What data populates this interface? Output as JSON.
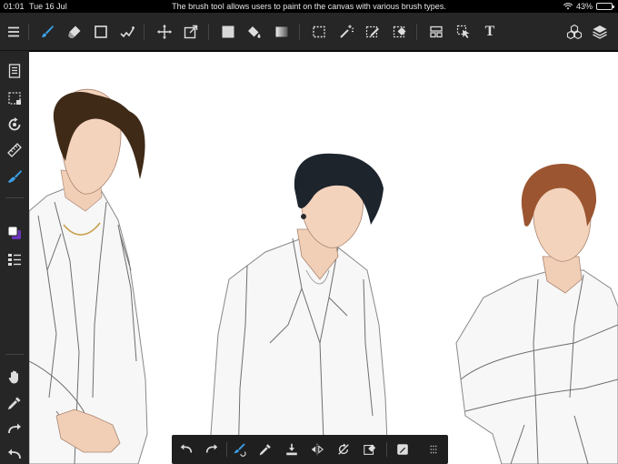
{
  "status_bar": {
    "time": "01:01",
    "date": "Tue 16 Jul",
    "tooltip": "The brush tool allows users to paint on the canvas with various brush types.",
    "battery": "43%",
    "battery_level": 0.43
  },
  "colors": {
    "accent": "#3ba0e6",
    "toolbar_bg": "#262626",
    "canvas_bg": "#ffffff",
    "primary_color": "#ffffff",
    "secondary_color": "#6a35b8"
  },
  "top_toolbar": {
    "items": [
      "menu-icon",
      "brush-icon",
      "eraser-icon",
      "rectangle-icon",
      "line-brush-icon",
      "move-icon",
      "transform-icon",
      "fill-color-icon",
      "bucket-fill-icon",
      "gradient-icon",
      "select-rectangle-icon",
      "magic-wand-icon",
      "select-pen-icon",
      "select-eraser-icon",
      "layout-icon",
      "select-arrow-icon",
      "text-tool-icon",
      "materials-icon",
      "layers-icon"
    ],
    "text_tool_label": "T"
  },
  "left_toolbar": {
    "items": [
      "pages-icon",
      "selection-icon",
      "rotate-view-icon",
      "ruler-icon",
      "paint-brush-icon",
      "color-swatch-icon",
      "layer-list-icon",
      "hand-icon",
      "eyedropper-icon",
      "redo-icon",
      "undo-icon"
    ]
  },
  "bottom_bar": {
    "items": [
      "undo-icon",
      "redo-icon",
      "brush-settings-icon",
      "eyedropper-icon",
      "import-icon",
      "flip-icon",
      "rotate-icon",
      "clear-icon",
      "edit-icon",
      "grid-icon"
    ]
  }
}
